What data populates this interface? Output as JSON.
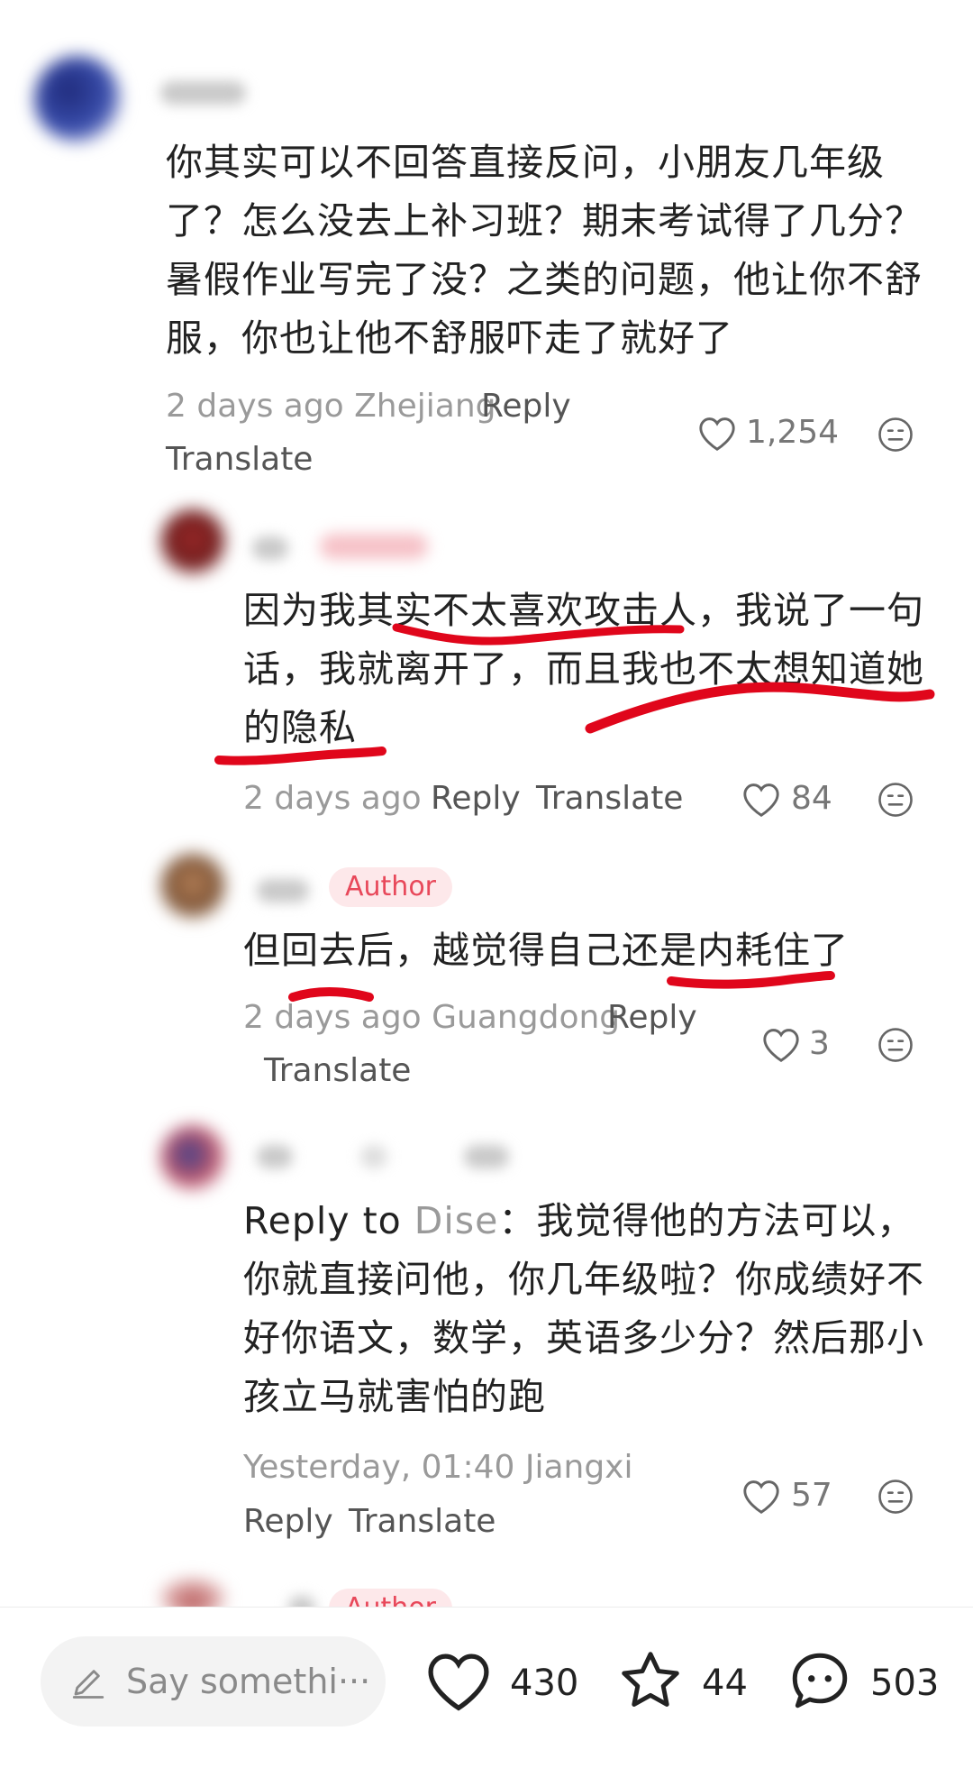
{
  "comments": [
    {
      "text": "你其实可以不回答直接反问，小朋友几年级了？怎么没去上补习班？期末考试得了几分？暑假作业写完了没？之类的问题，他让你不舒服，你也让他不舒服吓走了就好了",
      "meta": "2 days ago Zhejiang",
      "reply": "Reply",
      "translate": "Translate",
      "likes": "1,254"
    },
    {
      "text": "因为我其实不太喜欢攻击人，我说了一句话，我就离开了，而且我也不太想知道她的隐私",
      "meta": "2 days ago",
      "reply": "Reply",
      "translate": "Translate",
      "likes": "84"
    },
    {
      "badge": "Author",
      "text": "但回去后，越觉得自己还是内耗住了",
      "meta": "2 days ago Guangdong",
      "reply": "Reply",
      "translate": "Translate",
      "likes": "3"
    },
    {
      "reply_to_prefix": "Reply to",
      "reply_to_name": "Dise",
      "text": "：我觉得他的方法可以，你就直接问他，你几年级啦？你成绩好不好你语文，数学，英语多少分？然后那小孩立马就害怕的跑",
      "meta": "Yesterday, 01:40 Jiangxi",
      "reply": "Reply",
      "translate": "Translate",
      "likes": "57"
    },
    {
      "badge": "Author"
    }
  ],
  "bottom_bar": {
    "input_placeholder": "Say somethi···",
    "likes": "430",
    "favorites": "44",
    "comments": "503"
  },
  "colors": {
    "accent": "#e8485a",
    "underline": "#e0061b",
    "meta": "#9a9a9a"
  }
}
